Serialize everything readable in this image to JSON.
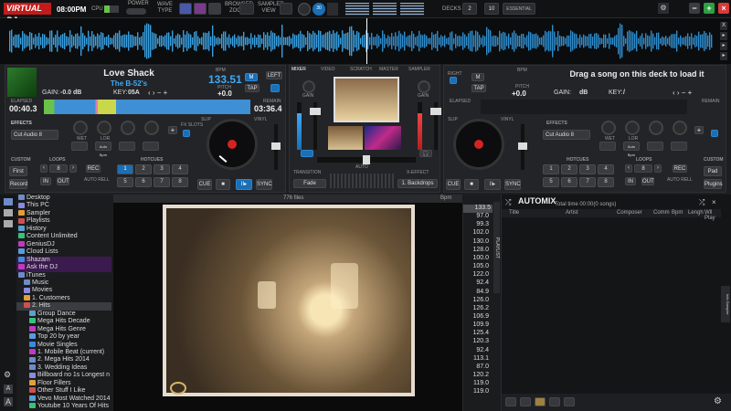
{
  "app": {
    "logo": "VIRTUAL DJ",
    "clock": "08:00PM",
    "cpu_label": "CPU",
    "power_label": "POWER",
    "wave_label": "WAVE",
    "type_label": "TYPE",
    "browser_zoom_label": "BROWSER ZOOM",
    "sampler_view_label": "SAMPLER VIEW",
    "decks_label": "DECKS",
    "decks_value": "2",
    "layout_value": "10",
    "deck_mode": "ESSENTIAL"
  },
  "deck_left": {
    "title": "Love Shack",
    "artist": "The B-52's",
    "bpm": "133.51",
    "bpm_label": "BPM",
    "pitch": "+0.0",
    "pitch_label": "PITCH",
    "gain_label": "GAIN:",
    "gain": "-0.0 dB",
    "key_label": "KEY:",
    "key": "05A",
    "elapsed_label": "ELAPSED",
    "elapsed": "00:40.3",
    "remain_label": "REMAIN",
    "remain": "03:36.4",
    "sync": "SYNC",
    "cue": "CUE",
    "left_label": "LEFT",
    "tap": "TAP",
    "m_label": "M",
    "effects_label": "EFFECTS",
    "effect": "Cut Audio 8",
    "wet": "WET",
    "lor": "LOR",
    "auto_bpm": "Auto Bpm",
    "custom_label": "CUSTOM",
    "custom1": "First",
    "custom2": "Record",
    "loops_label": "LOOPS",
    "loop_value": "8",
    "rec": "REC",
    "in": "IN",
    "out": "OUT",
    "auto": "AUTO",
    "reloop": "RELL",
    "hotcues_label": "HOTCUES",
    "slip": "SLIP",
    "vinyl": "VINYL",
    "pads": [
      "1",
      "2",
      "3",
      "4",
      "5",
      "6",
      "7",
      "8"
    ]
  },
  "deck_right": {
    "title": "Drag a song on this deck to load it",
    "right_label": "RIGHT",
    "tap": "TAP",
    "m_label": "M",
    "bpm_label": "BPM",
    "pitch_label": "PITCH",
    "pitch": "+0.0",
    "gain_label": "GAIN:",
    "gain": "dB",
    "key_label": "KEY:",
    "key": "/",
    "elapsed_label": "ELAPSED",
    "remain_label": "REMAIN",
    "sync": "SYNC",
    "cue": "CUE",
    "effects_label": "EFFECTS",
    "effect": "Cut Audio 8",
    "wet": "WET",
    "lor": "LOR",
    "auto_bpm": "Auto Bpm",
    "custom_label": "CUSTOM",
    "custom1": "Pad",
    "custom2": "Plugins",
    "loops_label": "LOOPS",
    "loop_value": "8",
    "rec": "REC",
    "in": "IN",
    "out": "OUT",
    "auto": "AUTO",
    "reloop": "RELL",
    "hotcues_label": "HOTCUES",
    "slip": "SLIP",
    "vinyl": "VINYL",
    "pads": [
      "1",
      "2",
      "3",
      "4",
      "5",
      "6",
      "7",
      "8"
    ]
  },
  "mixer": {
    "tabs": [
      "MIXER",
      "VIDEO",
      "SCRATCH",
      "MASTER",
      "SAMPLER"
    ],
    "gain": "GAIN",
    "transition_label": "TRANSITION",
    "transition": "Fade",
    "xeffect_label": "X-EFFECT",
    "xeffect": "1. Backdrops",
    "auto": "AUTO"
  },
  "browser": {
    "tree": [
      {
        "label": "Desktop",
        "indent": 1
      },
      {
        "label": "This PC",
        "indent": 1
      },
      {
        "label": "Sampler",
        "indent": 1
      },
      {
        "label": "Playlists",
        "indent": 1
      },
      {
        "label": "History",
        "indent": 1
      },
      {
        "label": "Content Unlimited",
        "indent": 1
      },
      {
        "label": "GeniusDJ",
        "indent": 1
      },
      {
        "label": "Cloud Lists",
        "indent": 1
      },
      {
        "label": "Shazam",
        "indent": 1
      },
      {
        "label": "Ask the DJ",
        "indent": 1
      },
      {
        "label": "iTunes",
        "indent": 1
      },
      {
        "label": "Music",
        "indent": 2
      },
      {
        "label": "Movies",
        "indent": 2
      },
      {
        "label": "1. Customers",
        "indent": 2
      },
      {
        "label": "2. Hits",
        "indent": 2
      },
      {
        "label": "Group Dance",
        "indent": 3
      },
      {
        "label": "Mega Hits Decade",
        "indent": 3
      },
      {
        "label": "Mega Hits Genre",
        "indent": 3
      },
      {
        "label": "Top 20 by year",
        "indent": 3
      },
      {
        "label": "Movie Singles",
        "indent": 3
      },
      {
        "label": "1. Mobile Beat (current)",
        "indent": 3
      },
      {
        "label": "2. Mega Hits 2014",
        "indent": 3
      },
      {
        "label": "3. Wedding Ideas",
        "indent": 3
      },
      {
        "label": "Billboard no 1s Longest n",
        "indent": 3
      },
      {
        "label": "Floor Fillers",
        "indent": 3
      },
      {
        "label": "Other Stuff I Like",
        "indent": 3
      },
      {
        "label": "Vevo Most Watched 2014",
        "indent": 3
      },
      {
        "label": "Youtube 10 Years Of Hits",
        "indent": 3
      }
    ],
    "files_label": "776 files",
    "bpm_header": "Bpm",
    "bpms": [
      "133.5",
      "97.0",
      "99.3",
      "102.0",
      "130.0",
      "128.0",
      "100.0",
      "105.0",
      "122.0",
      "92.4",
      "84.9",
      "126.0",
      "126.2",
      "106.9",
      "109.9",
      "125.4",
      "120.3",
      "92.4",
      "113.1",
      "87.0",
      "120.2",
      "119.0",
      "119.0"
    ],
    "side_tab": "PLAYLIST"
  },
  "automix": {
    "title": "AUTOMIX",
    "total": "Total time 00:00(0 songs)",
    "columns": [
      "Title",
      "Artist",
      "Composer",
      "Comm",
      "Bpm",
      "Lengh",
      "Wll Play"
    ],
    "side_tab": "Info Sampler"
  }
}
